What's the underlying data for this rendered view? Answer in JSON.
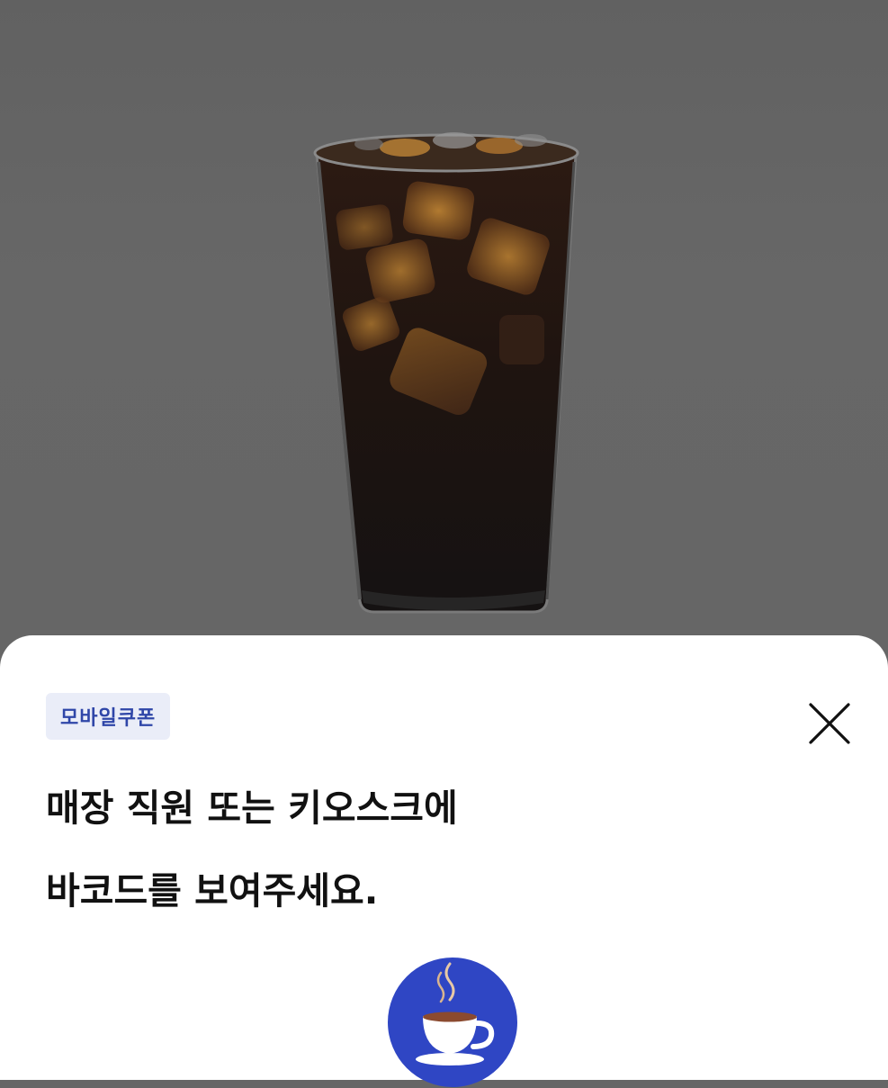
{
  "product": {
    "image_icon": "iced-americano-image"
  },
  "coupon_sheet": {
    "badge_label": "모바일쿠폰",
    "close_icon": "close-icon",
    "headline_line1": "매장 직원 또는 키오스크에",
    "headline_line2": "바코드를 보여주세요.",
    "coffee_icon": "coffee-cup-icon"
  },
  "colors": {
    "overlay": "#666666",
    "sheet_background": "#ffffff",
    "badge_background": "#eaedf8",
    "badge_text": "#2f46a8",
    "headline_text": "#111111",
    "coffee_icon_circle": "#2f46c4"
  }
}
